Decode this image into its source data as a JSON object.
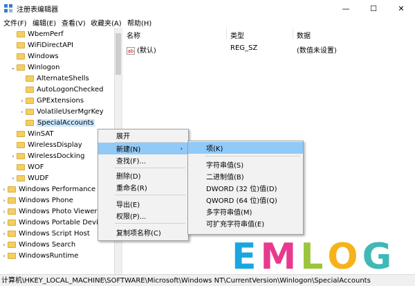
{
  "window": {
    "title": "注册表编辑器",
    "minimize": "—",
    "maximize": "☐",
    "close": "✕"
  },
  "menu": [
    "文件(F)",
    "编辑(E)",
    "查看(V)",
    "收藏夹(A)",
    "帮助(H)"
  ],
  "tree": [
    {
      "label": "WbemPerf",
      "indent": 2,
      "expander": ""
    },
    {
      "label": "WiFiDirectAPI",
      "indent": 2,
      "expander": ""
    },
    {
      "label": "Windows",
      "indent": 2,
      "expander": ""
    },
    {
      "label": "Winlogon",
      "indent": 2,
      "expander": "⌄"
    },
    {
      "label": "AlternateShells",
      "indent": 3,
      "expander": ""
    },
    {
      "label": "AutoLogonChecked",
      "indent": 3,
      "expander": ""
    },
    {
      "label": "GPExtensions",
      "indent": 3,
      "expander": "›"
    },
    {
      "label": "VolatileUserMgrKey",
      "indent": 3,
      "expander": "›"
    },
    {
      "label": "SpecialAccounts",
      "indent": 3,
      "expander": "",
      "selected": true
    },
    {
      "label": "WinSAT",
      "indent": 2,
      "expander": ""
    },
    {
      "label": "WirelessDisplay",
      "indent": 2,
      "expander": ""
    },
    {
      "label": "WirelessDocking",
      "indent": 2,
      "expander": "›"
    },
    {
      "label": "WOF",
      "indent": 2,
      "expander": ""
    },
    {
      "label": "WUDF",
      "indent": 2,
      "expander": "›"
    },
    {
      "label": "Windows Performance",
      "indent": 1,
      "expander": "›"
    },
    {
      "label": "Windows Phone",
      "indent": 1,
      "expander": "›"
    },
    {
      "label": "Windows Photo Viewer",
      "indent": 1,
      "expander": "›"
    },
    {
      "label": "Windows Portable Devices",
      "indent": 1,
      "expander": "›"
    },
    {
      "label": "Windows Script Host",
      "indent": 1,
      "expander": "›"
    },
    {
      "label": "Windows Search",
      "indent": 1,
      "expander": "›"
    },
    {
      "label": "WindowsRuntime",
      "indent": 1,
      "expander": "›"
    }
  ],
  "list": {
    "headers": {
      "name": "名称",
      "type": "类型",
      "data": "数据"
    },
    "rows": [
      {
        "icon": "ab",
        "name": "(默认)",
        "type": "REG_SZ",
        "data": "(数值未设置)"
      }
    ]
  },
  "context_menu": {
    "items": [
      "展开",
      "新建(N)",
      "查找(F)...",
      "删除(D)",
      "重命名(R)",
      "导出(E)",
      "权限(P)...",
      "复制项名称(C)"
    ],
    "submenu_arrow": "›"
  },
  "submenu": {
    "items": [
      "项(K)",
      "字符串值(S)",
      "二进制值(B)",
      "DWORD (32 位)值(D)",
      "QWORD (64 位)值(Q)",
      "多字符串值(M)",
      "可扩充字符串值(E)"
    ]
  },
  "status": "计算机\\HKEY_LOCAL_MACHINE\\SOFTWARE\\Microsoft\\Windows NT\\CurrentVersion\\Winlogon\\SpecialAccounts",
  "watermark": {
    "letters": [
      "E",
      "M",
      "L",
      "O",
      "G"
    ],
    "colors": [
      "#1aa7e0",
      "#e73a8e",
      "#9bc53d",
      "#f6b21b",
      "#3fb9b5"
    ]
  }
}
